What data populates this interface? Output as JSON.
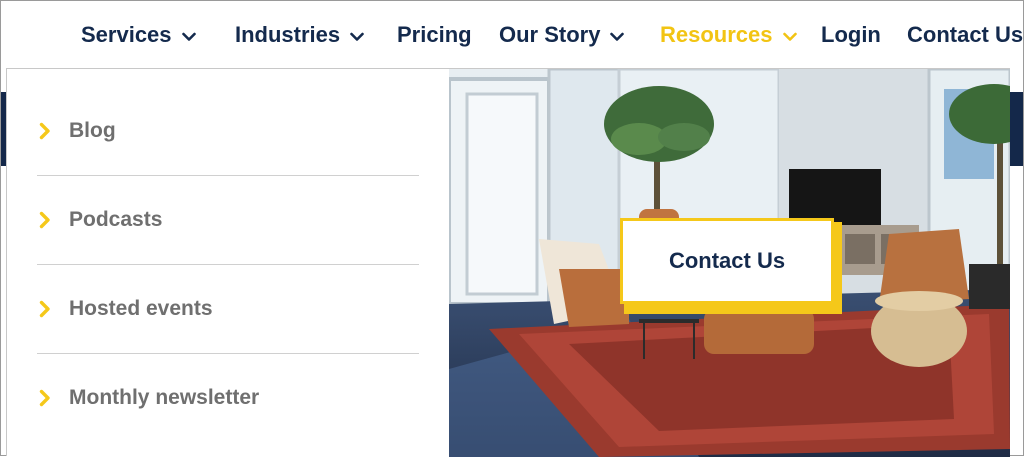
{
  "nav": {
    "items": [
      {
        "label": "Services",
        "has_dropdown": true,
        "active": false
      },
      {
        "label": "Industries",
        "has_dropdown": true,
        "active": false
      },
      {
        "label": "Pricing",
        "has_dropdown": false,
        "active": false
      },
      {
        "label": "Our Story",
        "has_dropdown": true,
        "active": false
      },
      {
        "label": "Resources",
        "has_dropdown": true,
        "active": true
      },
      {
        "label": "Login",
        "has_dropdown": false,
        "active": false
      },
      {
        "label": "Contact Us",
        "has_dropdown": false,
        "active": false
      }
    ]
  },
  "resources_menu": {
    "items": [
      {
        "label": "Blog"
      },
      {
        "label": "Podcasts"
      },
      {
        "label": "Hosted events"
      },
      {
        "label": "Monthly newsletter"
      }
    ],
    "cta_label": "Contact Us"
  },
  "colors": {
    "navy": "#142a4d",
    "accent_yellow": "#f5c81a",
    "menu_text_gray": "#6f6f6f"
  },
  "icons": {
    "nav_dropdown": "chevron-down-icon",
    "menu_bullet": "chevron-right-icon"
  }
}
